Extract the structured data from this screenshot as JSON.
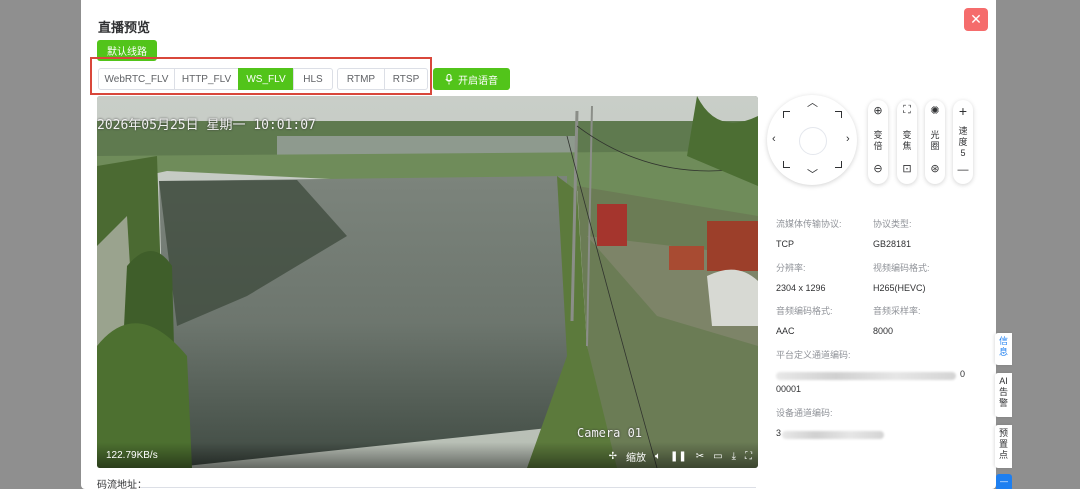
{
  "dialog": {
    "title": "直播预览",
    "close_icon": "close-icon",
    "close_glyph": "✕"
  },
  "route_button": "默认线路",
  "protocols": [
    {
      "label": "WebRTC_FLV",
      "active": false
    },
    {
      "label": "HTTP_FLV",
      "active": false
    },
    {
      "label": "WS_FLV",
      "active": true
    },
    {
      "label": "HLS",
      "active": false
    }
  ],
  "protocols2": [
    {
      "label": "RTMP",
      "active": false
    },
    {
      "label": "RTSP",
      "active": false
    }
  ],
  "voice_button": {
    "label": "开启语音",
    "icon": "microphone-icon"
  },
  "video": {
    "osd_datetime": "2026年05月25日 星期一 10:01:07",
    "osd_camera": "Camera 01",
    "bitrate": "122.79KB/s",
    "zoom_label": "缩放"
  },
  "ptz": {
    "zoom_label": "变\n倍",
    "focus_label": "变\n焦",
    "iris_label": "光\n圈",
    "speed_label": "速\n度",
    "speed_value": "5",
    "plus_glyph": "+",
    "minus_glyph": "—"
  },
  "info": {
    "transport_label": "流媒体传输协议:",
    "transport_value": "TCP",
    "protocol_label": "协议类型:",
    "protocol_value": "GB28181",
    "resolution_label": "分辨率:",
    "resolution_value": "2304 x 1296",
    "video_codec_label": "视频编码格式:",
    "video_codec_value": "H265(HEVC)",
    "audio_codec_label": "音频编码格式:",
    "audio_codec_value": "AAC",
    "sample_rate_label": "音频采样率:",
    "sample_rate_value": "8000",
    "platform_channel_label": "平台定义通道编码:",
    "platform_channel_tail": "0",
    "platform_channel_second": "00001",
    "device_channel_label": "设备通道编码:",
    "device_channel_prefix": "3"
  },
  "stream_address_label": "码流地址：",
  "side_tabs": [
    {
      "label": "信\n息",
      "active": true
    },
    {
      "label": "AI\n告\n警",
      "active": false
    },
    {
      "label": "预\n置\n点",
      "active": false
    }
  ],
  "colors": {
    "accent_green": "#52c41a",
    "highlight_red": "#d9473b",
    "close_red": "#f56c6c",
    "tab_blue": "#1e7ff0"
  }
}
